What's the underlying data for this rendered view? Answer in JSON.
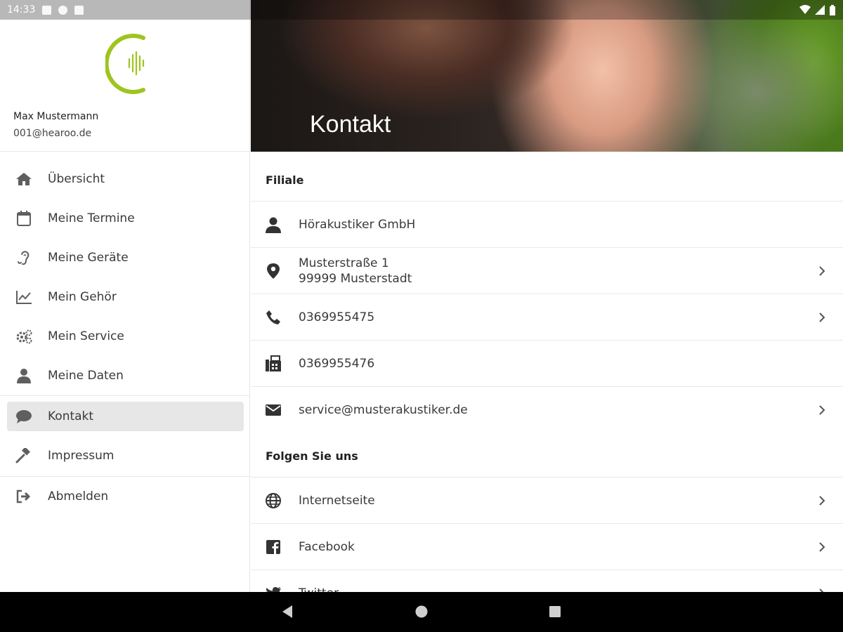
{
  "status_bar": {
    "time": "14:33"
  },
  "profile": {
    "name": "Max Mustermann",
    "email": "001@hearoo.de"
  },
  "nav": {
    "items": [
      {
        "label": "Übersicht",
        "icon": "home-icon"
      },
      {
        "label": "Meine Termine",
        "icon": "calendar-icon"
      },
      {
        "label": "Meine Geräte",
        "icon": "ear-icon"
      },
      {
        "label": "Mein Gehör",
        "icon": "chart-icon"
      },
      {
        "label": "Mein Service",
        "icon": "gears-icon"
      },
      {
        "label": "Meine Daten",
        "icon": "user-icon"
      },
      {
        "label": "Kontakt",
        "icon": "chat-icon",
        "active": true
      },
      {
        "label": "Impressum",
        "icon": "gavel-icon"
      },
      {
        "label": "Abmelden",
        "icon": "logout-icon"
      }
    ]
  },
  "header": {
    "title": "Kontakt"
  },
  "branch": {
    "heading": "Filiale",
    "company": "Hörakustiker GmbH",
    "address_line1": "Musterstraße 1",
    "address_line2": "99999 Musterstadt",
    "phone": "0369955475",
    "fax": "0369955476",
    "email": "service@musterakustiker.de"
  },
  "follow": {
    "heading": "Folgen Sie uns",
    "website": "Internetseite",
    "facebook": "Facebook",
    "twitter": "Twitter"
  },
  "colors": {
    "accent": "#9ec41f",
    "active_bg": "#e7e7e7",
    "icon": "#5f5f5f"
  }
}
